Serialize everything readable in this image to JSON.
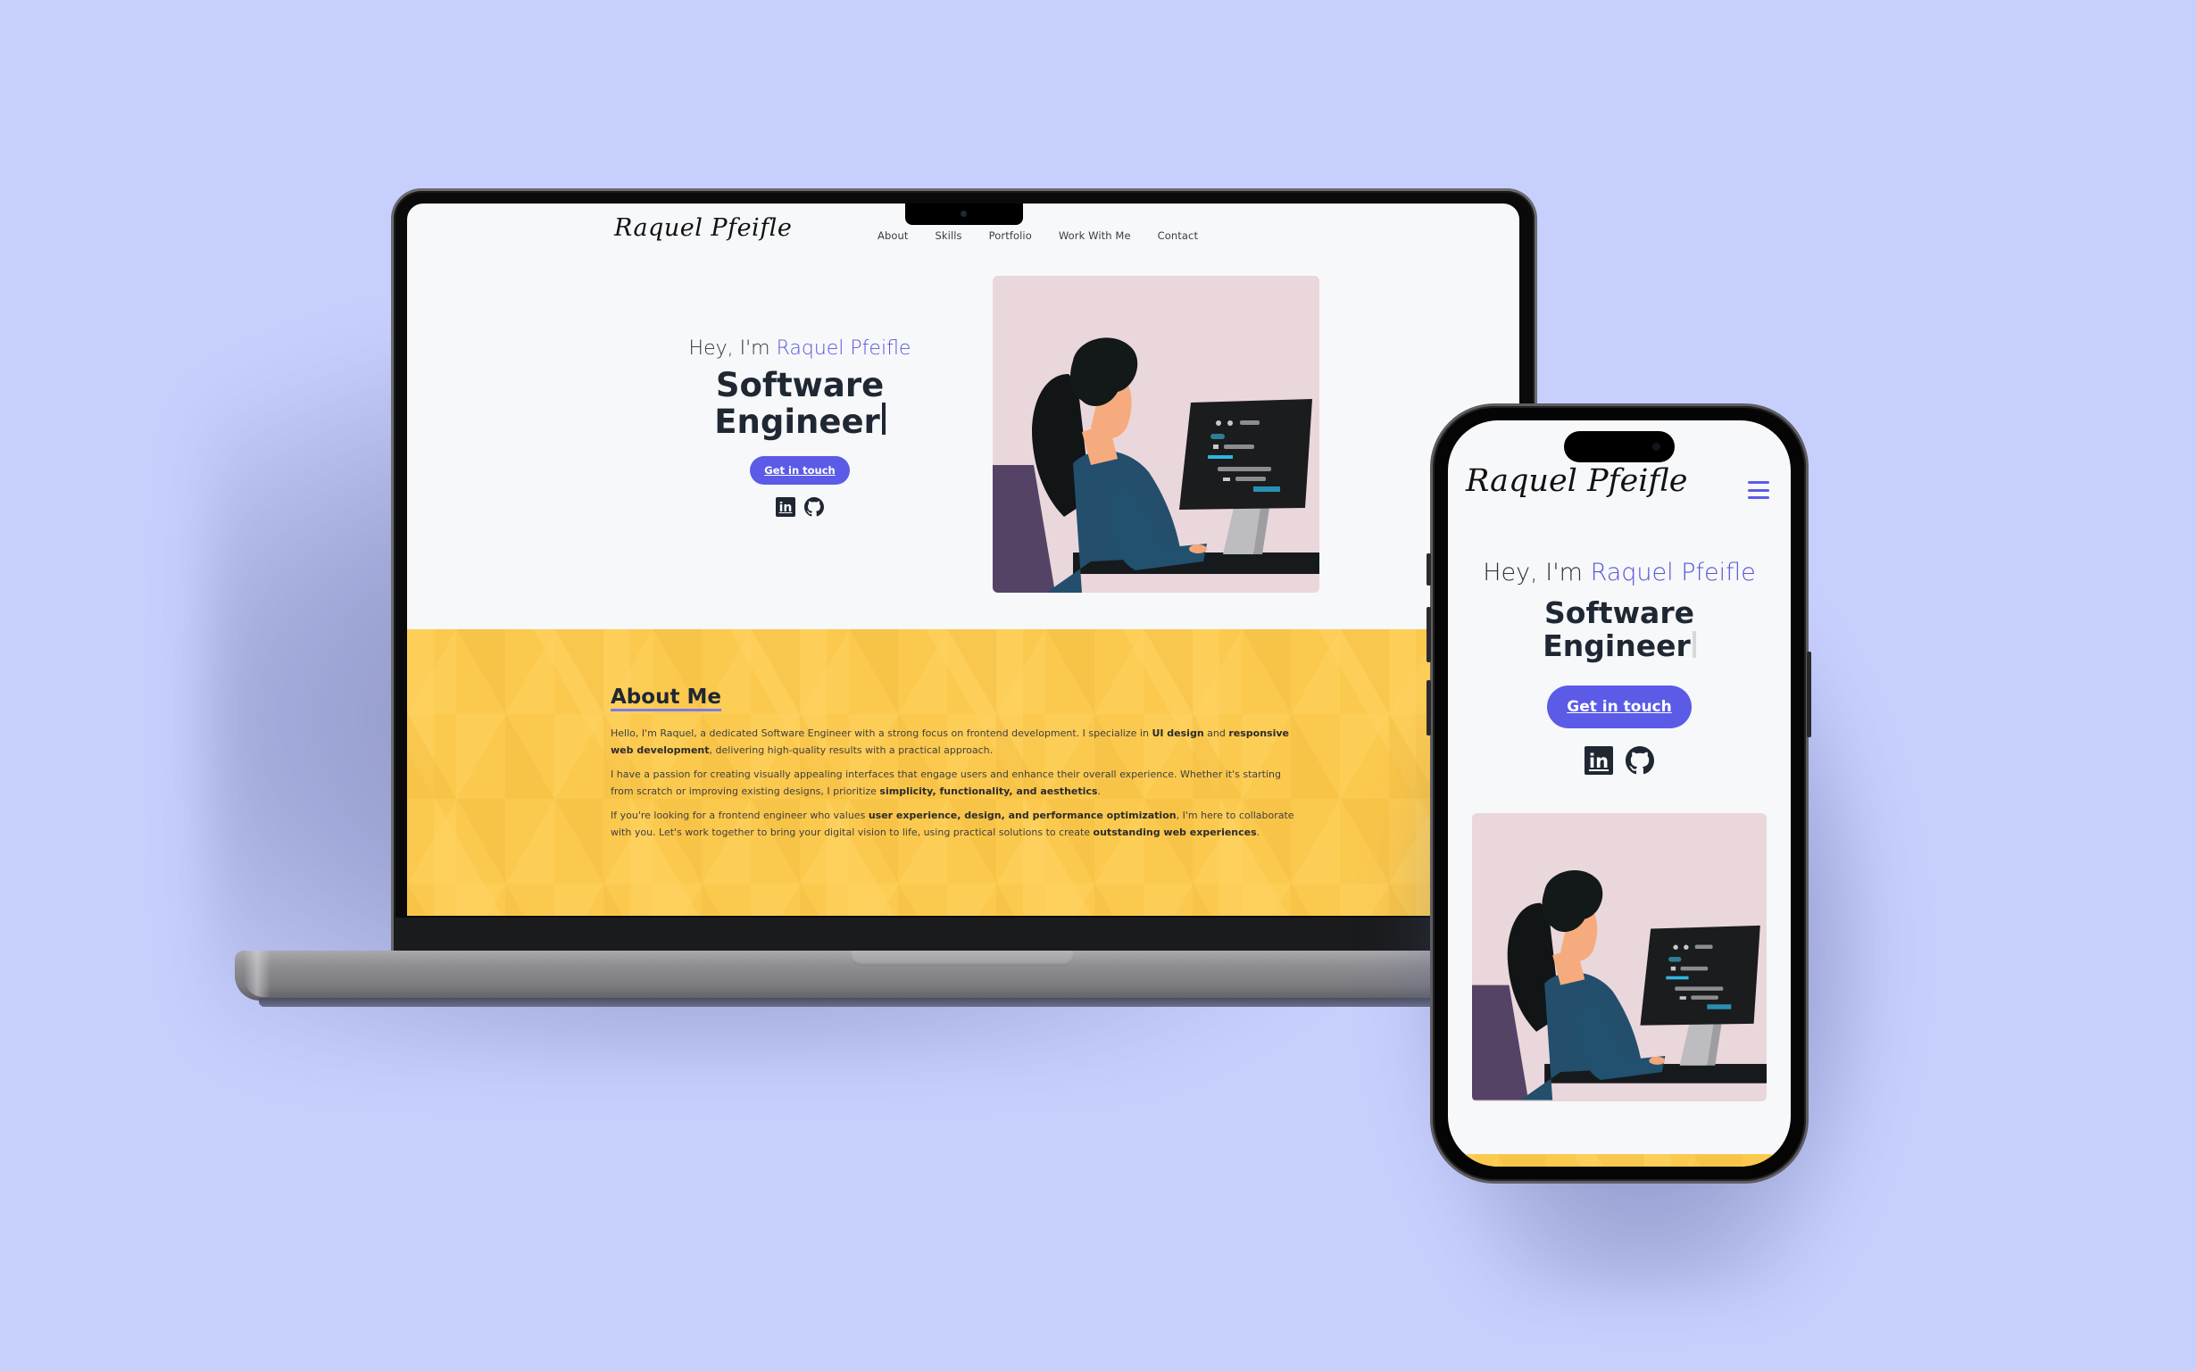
{
  "colors": {
    "background": "#c7cffd",
    "accent": "#5b5be8",
    "name_highlight": "#5555d8",
    "heading_text": "#1f2733",
    "about_bg": "#fcc94f",
    "about_underline": "#7b7bf0",
    "illustration_bg": "#ead7dc"
  },
  "site": {
    "logo": "Raquel Pfeifle",
    "nav": [
      {
        "label": "About"
      },
      {
        "label": "Skills"
      },
      {
        "label": "Portfolio"
      },
      {
        "label": "Work With Me"
      },
      {
        "label": "Contact"
      }
    ],
    "hero": {
      "greeting_prefix": "Hey, I'm ",
      "greeting_name": "Raquel Pfeifle",
      "role_line1": "Software",
      "role_line2": "Engineer",
      "cta_label": "Get in touch",
      "socials": [
        {
          "icon": "linkedin-icon",
          "glyph": "in"
        },
        {
          "icon": "github-icon"
        }
      ],
      "illustration": "woman-at-computer-illustration"
    },
    "about": {
      "title": "About Me",
      "paragraphs": [
        [
          {
            "text": "Hello, I'm Raquel, a dedicated Software Engineer with a strong focus on frontend development. I specialize in "
          },
          {
            "text": "UI design",
            "bold": true
          },
          {
            "text": " and "
          },
          {
            "text": "responsive web development",
            "bold": true
          },
          {
            "text": ", delivering high-quality results with a practical approach."
          }
        ],
        [
          {
            "text": "I have a passion for creating visually appealing interfaces that engage users and enhance their overall experience. Whether it's starting from scratch or improving existing designs, I prioritize "
          },
          {
            "text": "simplicity, functionality, and aesthetics",
            "bold": true
          },
          {
            "text": "."
          }
        ],
        [
          {
            "text": "If you're looking for a frontend engineer who values "
          },
          {
            "text": "user experience, design, and performance optimization",
            "bold": true
          },
          {
            "text": ", I'm here to collaborate with you. Let's work together to bring your digital vision to life, using practical solutions to create "
          },
          {
            "text": "outstanding web experiences",
            "bold": true
          },
          {
            "text": "."
          }
        ]
      ]
    }
  },
  "phone": {
    "menu_icon": "hamburger-menu-icon"
  }
}
